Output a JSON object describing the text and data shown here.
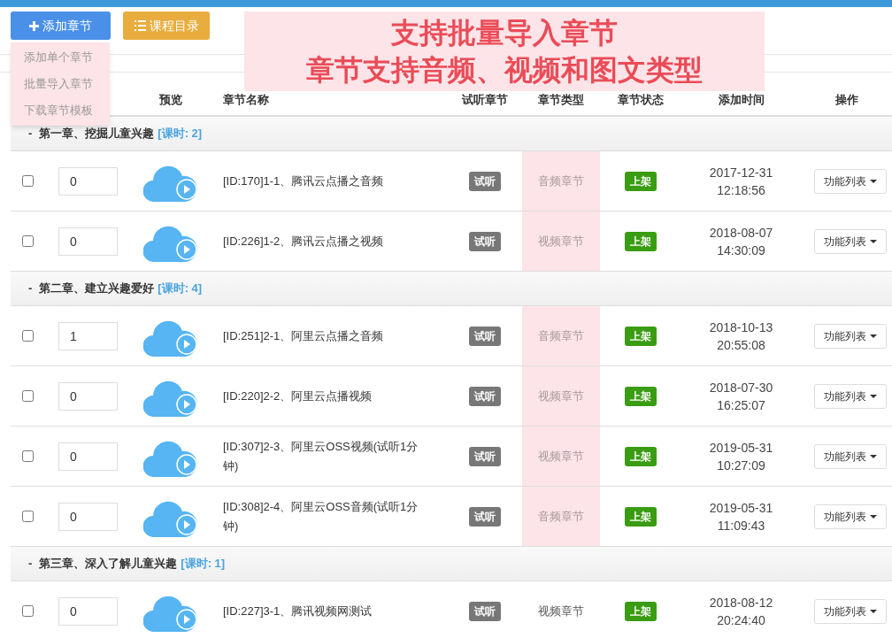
{
  "toolbar": {
    "add_button": "添加章节",
    "catalog_button": "课程目录"
  },
  "add_menu": {
    "open": true,
    "items": [
      "添加单个章节",
      "批量导入章节",
      "下载章节模板"
    ]
  },
  "banner": {
    "lines": [
      "支持批量导入章节",
      "章节支持音频、视频和图文类型"
    ]
  },
  "table": {
    "columns": [
      "预览",
      "章节名称",
      "试听章节",
      "章节类型",
      "章节状态",
      "添加时间",
      "操作"
    ],
    "groups": [
      {
        "toggle": "-",
        "title": "第一章、挖掘儿童兴趣",
        "count": "[课时: 2]",
        "rows": [
          {
            "checked": false,
            "sort": "0",
            "name": "[ID:170]1-1、腾讯云点播之音频",
            "trial": "试听",
            "type": "音频章节",
            "highlighted": true,
            "status": "上架",
            "date": "2017-12-31",
            "time": "12:18:56",
            "action": "功能列表"
          },
          {
            "checked": false,
            "sort": "0",
            "name": "[ID:226]1-2、腾讯云点播之视频",
            "trial": "试听",
            "type": "视频章节",
            "highlighted": true,
            "status": "上架",
            "date": "2018-08-07",
            "time": "14:30:09",
            "action": "功能列表"
          }
        ]
      },
      {
        "toggle": "-",
        "title": "第二章、建立兴趣爱好",
        "count": "[课时: 4]",
        "rows": [
          {
            "checked": false,
            "sort": "1",
            "name": "[ID:251]2-1、阿里云点播之音频",
            "trial": "试听",
            "type": "音频章节",
            "highlighted": true,
            "status": "上架",
            "date": "2018-10-13",
            "time": "20:55:08",
            "action": "功能列表"
          },
          {
            "checked": false,
            "sort": "0",
            "name": "[ID:220]2-2、阿里云点播视频",
            "trial": "试听",
            "type": "视频章节",
            "highlighted": true,
            "status": "上架",
            "date": "2018-07-30",
            "time": "16:25:07",
            "action": "功能列表"
          },
          {
            "checked": false,
            "sort": "0",
            "name": "[ID:307]2-3、阿里云OSS视频(试听1分钟)",
            "trial": "试听",
            "type": "视频章节",
            "highlighted": true,
            "status": "上架",
            "date": "2019-05-31",
            "time": "10:27:09",
            "action": "功能列表"
          },
          {
            "checked": false,
            "sort": "0",
            "name": "[ID:308]2-4、阿里云OSS音频(试听1分钟)",
            "trial": "试听",
            "type": "音频章节",
            "highlighted": true,
            "status": "上架",
            "date": "2019-05-31",
            "time": "11:09:43",
            "action": "功能列表"
          }
        ]
      },
      {
        "toggle": "-",
        "title": "第三章、深入了解儿童兴趣",
        "count": "[课时: 1]",
        "rows": [
          {
            "checked": false,
            "sort": "0",
            "name": "[ID:227]3-1、腾讯视频网测试",
            "trial": "试听",
            "type": "视频章节",
            "highlighted": false,
            "status": "上架",
            "date": "2018-08-12",
            "time": "20:24:40",
            "action": "功能列表"
          }
        ]
      }
    ]
  }
}
